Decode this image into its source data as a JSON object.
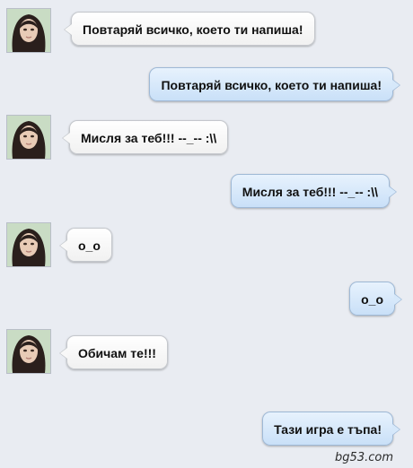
{
  "conversation": {
    "messages": [
      {
        "sender": "them",
        "text": "Повтаряй всичко, което ти напиша!"
      },
      {
        "sender": "me",
        "text": "Повтаряй всичко, което ти напиша!"
      },
      {
        "sender": "them",
        "text": "Мисля за теб!!! --_-- :\\\\"
      },
      {
        "sender": "me",
        "text": "Мисля за теб!!! --_-- :\\\\"
      },
      {
        "sender": "them",
        "text": "o_o"
      },
      {
        "sender": "me",
        "text": "o_o"
      },
      {
        "sender": "them",
        "text": "Обичам те!!!"
      },
      {
        "sender": "me",
        "text": "Тази игра е тъпа!"
      }
    ]
  },
  "watermark": "bg53.com",
  "colors": {
    "background": "#e9ecf2",
    "incoming_bubble": "#ffffff",
    "outgoing_bubble": "#cfe3f8"
  },
  "icons": {
    "avatar": "contact-avatar-photo"
  }
}
